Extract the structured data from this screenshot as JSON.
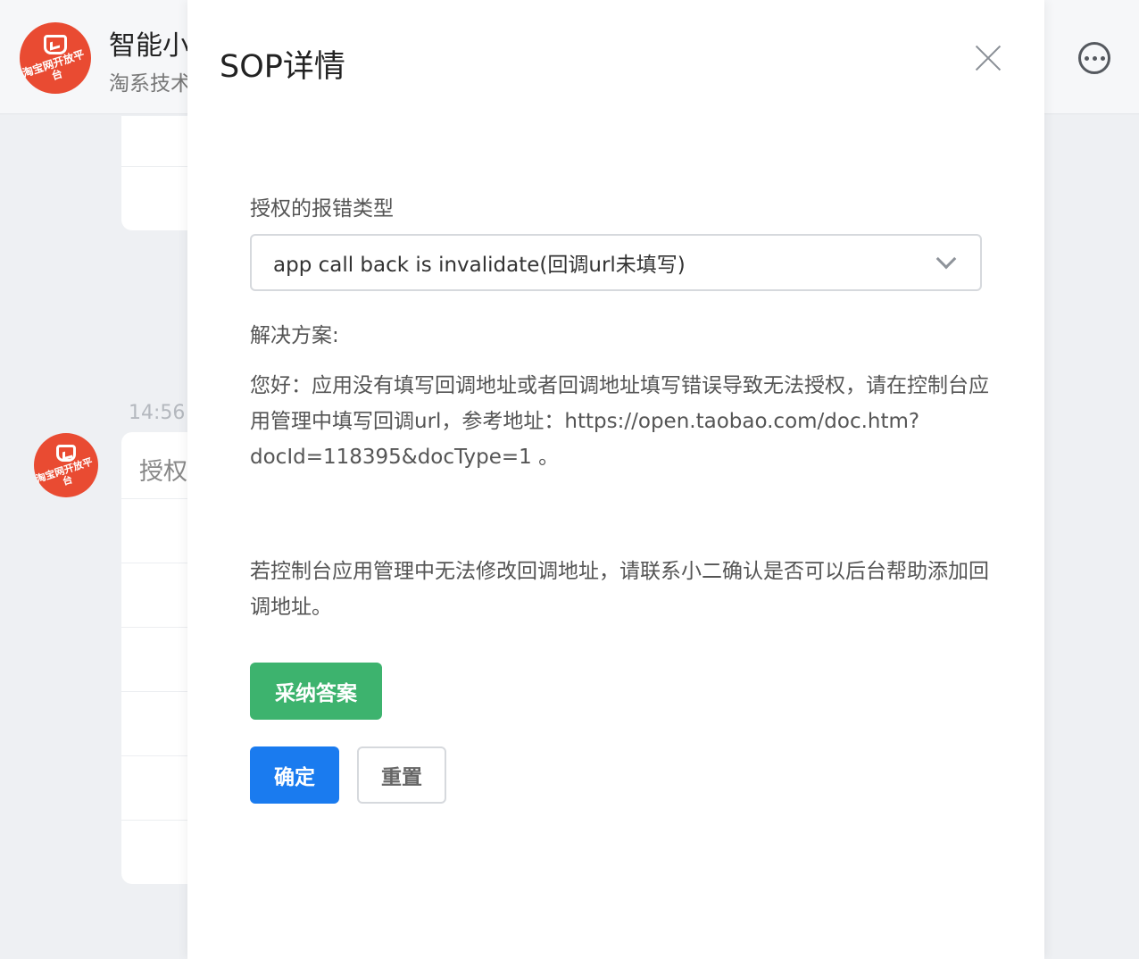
{
  "chat": {
    "name": "智能小",
    "subtitle": "淘系技术",
    "logo_text": "淘宝网开放平台",
    "time": "14:56",
    "bubble_text": "授权"
  },
  "drawer": {
    "title": "SOP详情",
    "field_label": "授权的报错类型",
    "select_value": "app call back is invalidate(回调url未填写)",
    "solution_label": "解决方案:",
    "paragraph_1": "您好：应用没有填写回调地址或者回调地址填写错误导致无法授权，请在控制台应用管理中填写回调url，参考地址：https://open.taobao.com/doc.htm?docId=118395&docType=1 。",
    "paragraph_2": "若控制台应用管理中无法修改回调地址，请联系小二确认是否可以后台帮助添加回调地址。",
    "accept_button": "采纳答案",
    "confirm_button": "确定",
    "reset_button": "重置"
  },
  "colors": {
    "accept": "#3db36e",
    "primary": "#1a7bef",
    "logo": "#e94b32"
  }
}
